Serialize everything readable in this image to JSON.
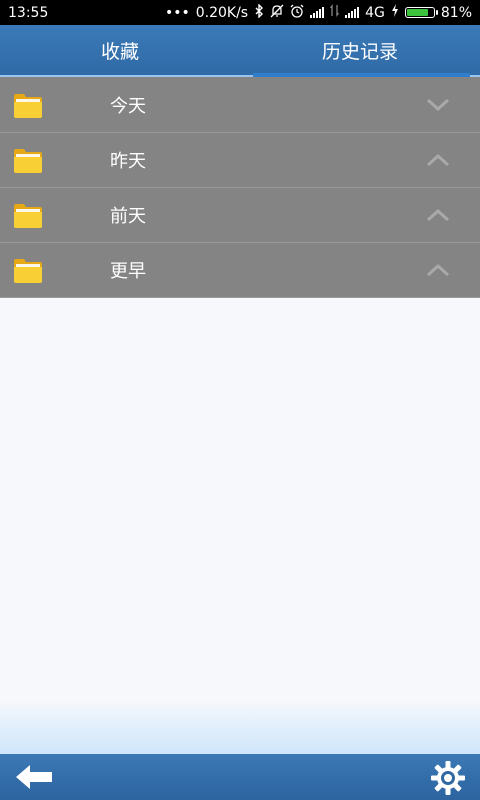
{
  "status": {
    "time": "13:55",
    "dots": "•••",
    "speed": "0.20K/s",
    "network": "4G",
    "battery": "81%",
    "battery_level": 81
  },
  "tabs": [
    {
      "label": "收藏",
      "active": false
    },
    {
      "label": "历史记录",
      "active": true
    }
  ],
  "history": [
    {
      "label": "今天",
      "chevron": "down"
    },
    {
      "label": "昨天",
      "chevron": "up"
    },
    {
      "label": "前天",
      "chevron": "up"
    },
    {
      "label": "更早",
      "chevron": "up"
    }
  ],
  "colors": {
    "header": "#2f6aa6",
    "row": "#848484",
    "folder": "#f7c92a"
  },
  "icons": {
    "back": "back-arrow-icon",
    "settings": "gear-icon",
    "folder": "folder-icon"
  }
}
